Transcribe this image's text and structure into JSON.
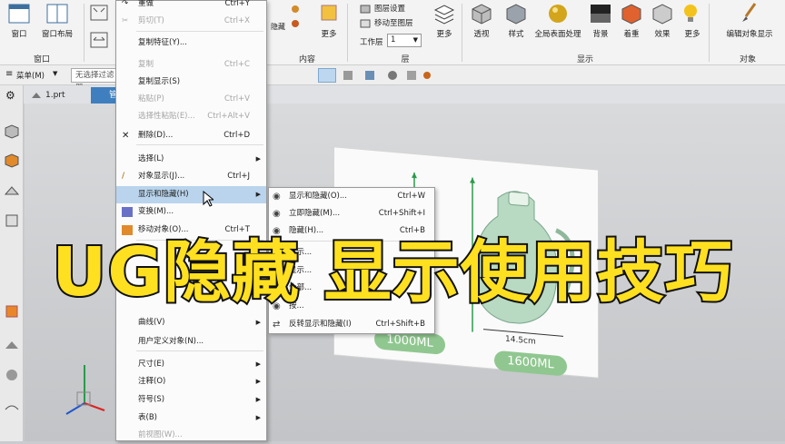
{
  "ribbon": {
    "window_group": {
      "label": "窗口",
      "items": [
        "窗口",
        "窗口布局"
      ]
    },
    "content_group": {
      "label": "内容",
      "items": [
        "隐藏",
        "更多"
      ]
    },
    "layer_group": {
      "label": "层",
      "items": [
        "图层设置",
        "移动至图层"
      ],
      "work_layer_label": "工作层",
      "work_layer_value": "1",
      "more": "更多"
    },
    "display_group": {
      "label": "显示",
      "items": [
        "透视",
        "样式",
        "全局表面处理",
        "背景",
        "着重",
        "效果",
        "更多"
      ]
    },
    "object_group": {
      "label": "对象",
      "items": [
        "编辑对象显示"
      ]
    }
  },
  "toolbar2": {
    "menu_label": "菜单(M)",
    "filter_placeholder": "无选择过滤器"
  },
  "tabs": [
    {
      "label": "1.prt"
    },
    {
      "label": "管"
    }
  ],
  "context_menu": [
    {
      "label": "重做",
      "shortcut": "Ctrl+Y",
      "disabled": false,
      "icon": "redo-icon"
    },
    {
      "label": "剪切(T)",
      "shortcut": "Ctrl+X",
      "disabled": true,
      "icon": "scissors-icon"
    },
    {
      "label": "复制特征(Y)...",
      "shortcut": "",
      "disabled": false
    },
    {
      "label": "复制",
      "shortcut": "Ctrl+C",
      "disabled": true
    },
    {
      "label": "复制显示(S)",
      "shortcut": "",
      "disabled": false
    },
    {
      "label": "粘贴(P)",
      "shortcut": "Ctrl+V",
      "disabled": true
    },
    {
      "label": "选择性粘贴(E)...",
      "shortcut": "Ctrl+Alt+V",
      "disabled": true
    },
    {
      "label": "删除(D)...",
      "shortcut": "Ctrl+D",
      "disabled": false,
      "icon": "delete-icon"
    },
    {
      "label": "选择(L)",
      "shortcut": "",
      "disabled": false,
      "submenu": true
    },
    {
      "label": "对象显示(J)...",
      "shortcut": "Ctrl+J",
      "disabled": false,
      "icon": "brush-icon"
    },
    {
      "label": "显示和隐藏(H)",
      "shortcut": "",
      "disabled": false,
      "submenu": true,
      "highlighted": true
    },
    {
      "label": "变换(M)...",
      "shortcut": "",
      "disabled": false,
      "icon": "transform-icon"
    },
    {
      "label": "移动对象(O)...",
      "shortcut": "Ctrl+T",
      "disabled": false,
      "icon": "move-icon"
    },
    {
      "label": "曲线(V)",
      "shortcut": "",
      "disabled": false,
      "submenu": true
    },
    {
      "label": "用户定义对象(N)...",
      "shortcut": "",
      "disabled": false
    },
    {
      "label": "尺寸(E)",
      "shortcut": "",
      "disabled": false,
      "submenu": true
    },
    {
      "label": "注释(O)",
      "shortcut": "",
      "disabled": false,
      "submenu": true
    },
    {
      "label": "符号(S)",
      "shortcut": "",
      "disabled": false,
      "submenu": true
    },
    {
      "label": "表(B)",
      "shortcut": "",
      "disabled": false,
      "submenu": true
    },
    {
      "label": "前视图(W)...",
      "shortcut": "",
      "disabled": true
    }
  ],
  "submenu": [
    {
      "label": "显示和隐藏(O)...",
      "shortcut": "Ctrl+W"
    },
    {
      "label": "立即隐藏(M)...",
      "shortcut": "Ctrl+Shift+I"
    },
    {
      "label": "隐藏(H)...",
      "shortcut": "Ctrl+B"
    },
    {
      "label": "显示...",
      "shortcut": ""
    },
    {
      "label": "显示...",
      "shortcut": ""
    },
    {
      "label": "全部...",
      "shortcut": ""
    },
    {
      "label": "按...",
      "shortcut": ""
    },
    {
      "label": "反转显示和隐藏(I)",
      "shortcut": "Ctrl+Shift+B"
    }
  ],
  "viewport": {
    "badge_1": "1000ML",
    "badge_2": "1600ML",
    "dimension": "14.5cm"
  },
  "overlay_title": "UG隐藏 显示使用技巧",
  "colors": {
    "overlay_fill": "#ffe020",
    "overlay_stroke": "#111111",
    "menu_highlight": "#b9d4ec",
    "badge_green": "#90c790"
  }
}
